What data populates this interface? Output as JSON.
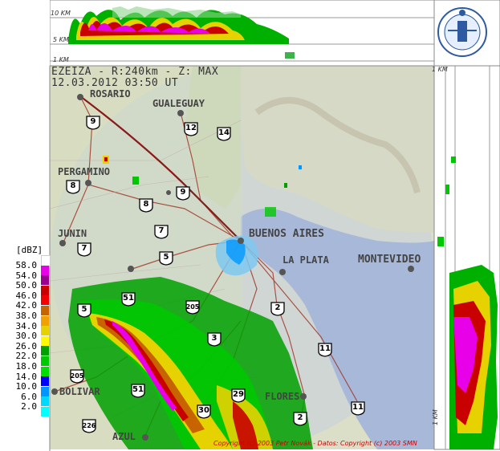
{
  "header": {
    "line1": "EZEIZA - R:240km - Z: MAX",
    "line2": "12.03.2012 03:50 UT"
  },
  "heights": {
    "h10": "10 KM",
    "h5": "5 KM",
    "h1": "1 KM"
  },
  "legend": {
    "title": "[dBZ]",
    "entries": [
      {
        "value": "58.0",
        "color": "#ffffff"
      },
      {
        "value": "54.0",
        "color": "#e800e8"
      },
      {
        "value": "50.0",
        "color": "#9a0090"
      },
      {
        "value": "46.0",
        "color": "#c80000"
      },
      {
        "value": "42.0",
        "color": "#f00000"
      },
      {
        "value": "38.0",
        "color": "#c86400"
      },
      {
        "value": "34.0",
        "color": "#f0a000"
      },
      {
        "value": "30.0",
        "color": "#e6d200"
      },
      {
        "value": "26.0",
        "color": "#fffa00"
      },
      {
        "value": "22.0",
        "color": "#00a000"
      },
      {
        "value": "18.0",
        "color": "#00c800"
      },
      {
        "value": "14.0",
        "color": "#00e000"
      },
      {
        "value": "10.0",
        "color": "#0000ff"
      },
      {
        "value": "6.0",
        "color": "#0096ff"
      },
      {
        "value": "2.0",
        "color": "#00d8ff"
      },
      {
        "value": "",
        "color": "#00ffff"
      }
    ]
  },
  "cities": {
    "rosario": "ROSARIO",
    "gualeguay": "GUALEGUAY",
    "pergamino": "PERGAMINO",
    "junin": "JUNIN",
    "buenos_aires": "BUENOS AIRES",
    "la_plata": "LA PLATA",
    "montevideo": "MONTEVIDEO",
    "bolivar": "BOLIVAR",
    "azul": "AZUL",
    "las_flores": "FLORES"
  },
  "routes": [
    "9",
    "12",
    "14",
    "8",
    "9",
    "8",
    "7",
    "7",
    "5",
    "51",
    "5",
    "205",
    "3",
    "2",
    "11",
    "205",
    "51",
    "29",
    "30",
    "2",
    "11",
    "226"
  ],
  "copyright": "Copyright (c) 2003 Petr Novák - Datos: Copyright (c) 2003 SMN",
  "side_labels": {
    "right_x": "1 KM",
    "bottom_y": "1 KM"
  }
}
